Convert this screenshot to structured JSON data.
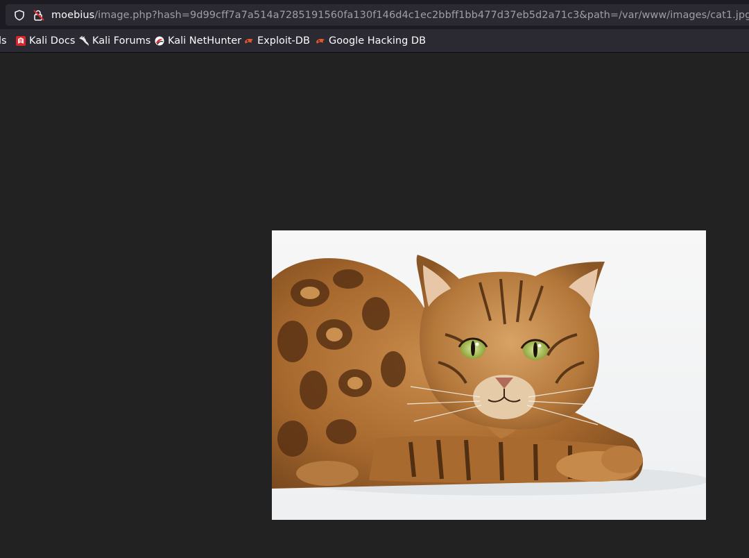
{
  "address_bar": {
    "host": "moebius",
    "path": "/image.php?hash=9d99cff7a7a514a7285191560fa130f146d4c1ec2bbff1bb477d37eb5d2a71c3&path=/var/www/images/cat1.jpg"
  },
  "bookmarks": {
    "items": [
      {
        "label": "ls",
        "icon": "truncated"
      },
      {
        "label": "Kali Docs",
        "icon": "kali-docs-icon"
      },
      {
        "label": "Kali Forums",
        "icon": "kali-dragon-icon"
      },
      {
        "label": "Kali NetHunter",
        "icon": "nethunter-icon"
      },
      {
        "label": "Exploit-DB",
        "icon": "exploit-db-icon"
      },
      {
        "label": "Google Hacking DB",
        "icon": "exploit-db-icon"
      }
    ]
  },
  "colors": {
    "page_background": "#222222",
    "toolbar": "#1c1b22",
    "urlbar": "#2b2a33",
    "accent_red": "#e22d2d",
    "exploit_orange": "#e8572a"
  },
  "image": {
    "subject": "bengal-cat"
  }
}
